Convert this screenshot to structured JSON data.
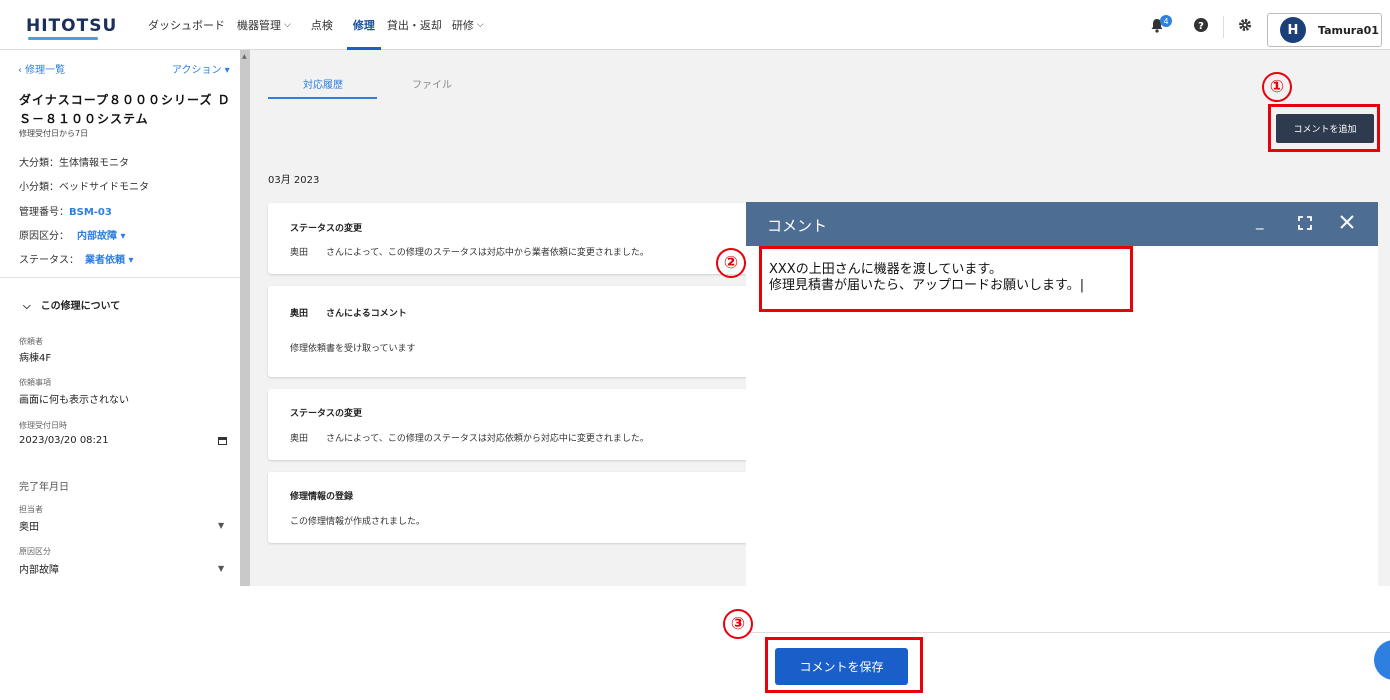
{
  "header": {
    "logo": "HITOTSU",
    "nav": [
      {
        "label": "ダッシュボード",
        "chevron": false,
        "active": false
      },
      {
        "label": "機器管理",
        "chevron": true,
        "active": false
      },
      {
        "label": "点検",
        "chevron": false,
        "active": false
      },
      {
        "label": "修理",
        "chevron": false,
        "active": true
      },
      {
        "label": "貸出・返却",
        "chevron": false,
        "active": false
      },
      {
        "label": "研修",
        "chevron": true,
        "active": false
      }
    ],
    "notification_count": "4",
    "avatar_letter": "H",
    "user_name": "Tamura01"
  },
  "sidebar": {
    "back_link": "‹ 修理一覧",
    "action_menu": "アクション ▾",
    "title": "ダイナスコープ８０００シリーズ ＤＳ－８１００システム",
    "subtitle": "修理受付日から7日",
    "major_category": "大分類：生体情報モニタ",
    "minor_category": "小分類：ベッドサイドモニタ",
    "management_no_label": "管理番号：",
    "management_no_value": "BSM-03",
    "cause_label": "原因区分：",
    "cause_value": "内部故障 ▾",
    "status_label": "ステータス：",
    "status_value": "業者依頼 ▾",
    "section_title": "この修理について",
    "fields": {
      "requester_label": "依頼者",
      "requester_value": "病棟4F",
      "request_label": "依頼事項",
      "request_value": "画面に何も表示されない",
      "received_label": "修理受付日時",
      "received_value": "2023/03/20 08:21",
      "completed_label": "完了年月日",
      "assignee_label": "担当者",
      "assignee_value": "奥田",
      "cause_label": "原因区分",
      "cause_value": "内部故障"
    }
  },
  "main": {
    "tabs": [
      "対応履歴",
      "ファイル"
    ],
    "add_comment_button": "コメントを追加",
    "month": "03月 2023",
    "cards": [
      {
        "title": "ステータスの変更",
        "text": "奥田　　さんによって、この修理のステータスは対応中から業者依頼に変更されました。"
      },
      {
        "title": "奥田　　さんによるコメント",
        "text": "修理依頼書を受け取っています"
      },
      {
        "title": "ステータスの変更",
        "text": "奥田　　さんによって、この修理のステータスは対応依頼から対応中に変更されました。"
      },
      {
        "title": "修理情報の登録",
        "text": "この修理情報が作成されました。"
      }
    ]
  },
  "comment_panel": {
    "title": "コメント",
    "text": "XXXの上田さんに機器を渡しています。\n修理見積書が届いたら、アップロードお願いします。|",
    "save_button": "コメントを保存"
  },
  "annotations": [
    "①",
    "②",
    "③"
  ],
  "colors": {
    "accent": "#2d7fe0",
    "primary_button": "#1a5fc9",
    "dark_button": "#2e3a4e",
    "panel_header": "#4e6d93",
    "highlight": "#e8000b"
  }
}
